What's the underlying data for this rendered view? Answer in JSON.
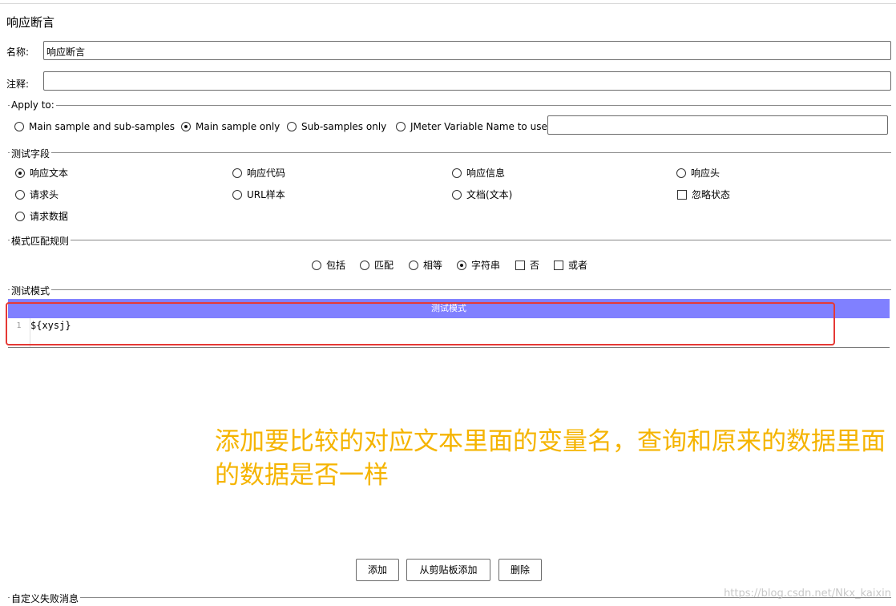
{
  "panel": {
    "title": "响应断言"
  },
  "name_field": {
    "label": "名称:",
    "value": "响应断言"
  },
  "comment_field": {
    "label": "注释:",
    "value": ""
  },
  "apply_to": {
    "label": "Apply to:",
    "options": [
      {
        "label": "Main sample and sub-samples",
        "selected": false
      },
      {
        "label": "Main sample only",
        "selected": true
      },
      {
        "label": "Sub-samples only",
        "selected": false
      },
      {
        "label": "JMeter Variable Name to use",
        "selected": false
      }
    ],
    "variable_value": ""
  },
  "test_field": {
    "label": "测试字段",
    "options": [
      {
        "label": "响应文本",
        "selected": true,
        "kind": "radio"
      },
      {
        "label": "响应代码",
        "selected": false,
        "kind": "radio"
      },
      {
        "label": "响应信息",
        "selected": false,
        "kind": "radio"
      },
      {
        "label": "响应头",
        "selected": false,
        "kind": "radio"
      },
      {
        "label": "请求头",
        "selected": false,
        "kind": "radio"
      },
      {
        "label": "URL样本",
        "selected": false,
        "kind": "radio"
      },
      {
        "label": "文档(文本)",
        "selected": false,
        "kind": "radio"
      },
      {
        "label": "忽略状态",
        "selected": false,
        "kind": "checkbox"
      },
      {
        "label": "请求数据",
        "selected": false,
        "kind": "radio"
      }
    ]
  },
  "pattern_rule": {
    "label": "模式匹配规则",
    "options": [
      {
        "label": "包括",
        "selected": false,
        "kind": "radio"
      },
      {
        "label": "匹配",
        "selected": false,
        "kind": "radio"
      },
      {
        "label": "相等",
        "selected": false,
        "kind": "radio"
      },
      {
        "label": "字符串",
        "selected": true,
        "kind": "radio"
      },
      {
        "label": "否",
        "selected": false,
        "kind": "checkbox"
      },
      {
        "label": "或者",
        "selected": false,
        "kind": "checkbox"
      }
    ]
  },
  "test_patterns": {
    "label": "测试模式",
    "header": "测试模式",
    "lines": [
      {
        "number": "1",
        "text": "${xysj}"
      }
    ]
  },
  "annotation": "添加要比较的对应文本里面的变量名，查询和原来的数据里面的数据是否一样",
  "buttons": {
    "add": "添加",
    "add_from_clipboard": "从剪贴板添加",
    "delete": "删除"
  },
  "custom_failure": {
    "label": "自定义失败消息"
  },
  "watermark": "https://blog.csdn.net/Nkx_kaixin",
  "colors": {
    "editor_header": "#8080ff",
    "highlight_box": "#e53935",
    "annotation": "#f5b400"
  }
}
